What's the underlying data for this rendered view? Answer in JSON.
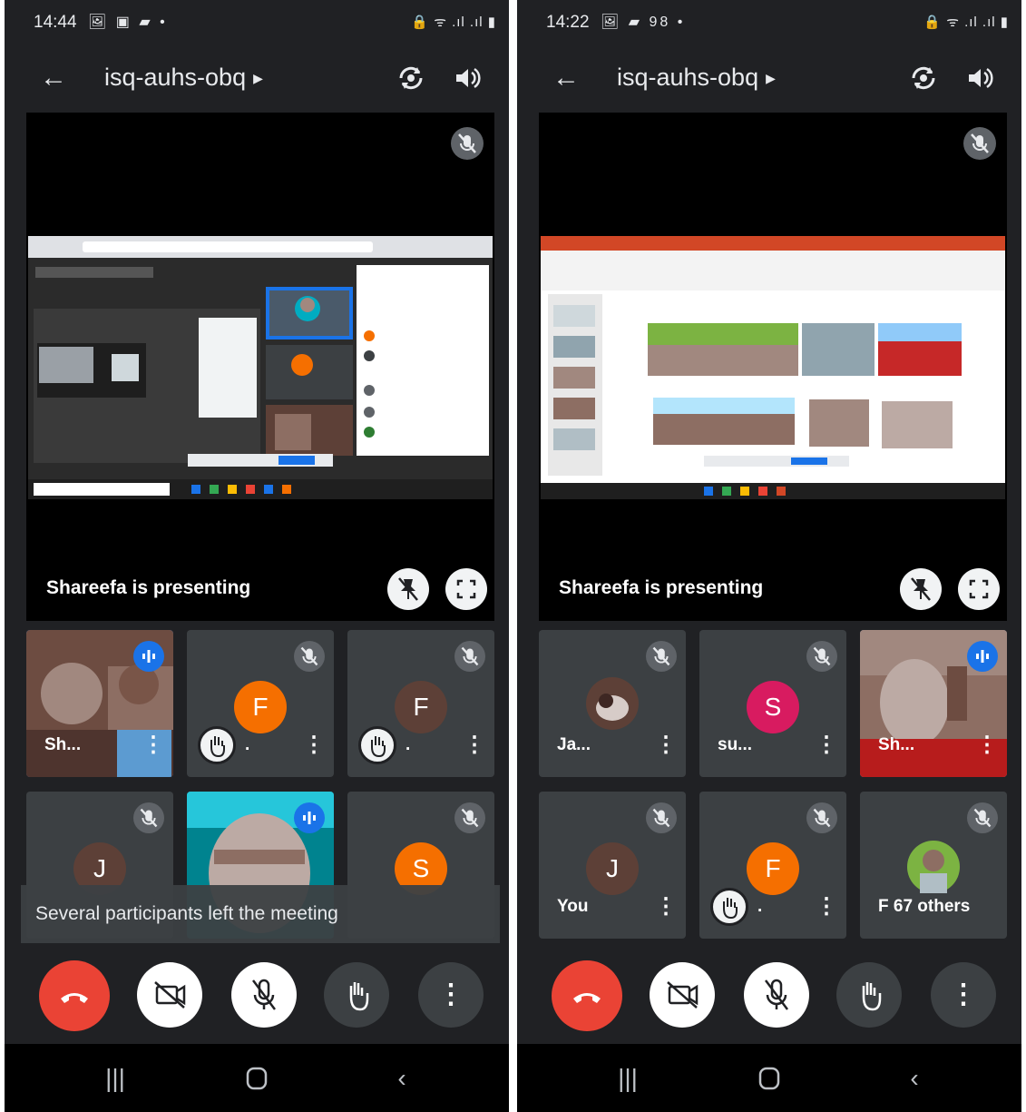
{
  "screens": [
    {
      "status": {
        "time": "14:44",
        "notif_icons": "🖼 ▣ ▰ •"
      },
      "meeting_code": "isq-auhs-obq",
      "presenter_label": "Shareefa is presenting",
      "toast": "Several participants left the meeting",
      "tiles": [
        {
          "name": "Sh...",
          "kind": "video",
          "speaking": true
        },
        {
          "name": ".",
          "kind": "avatar",
          "initial": "F",
          "avatar_color": "#f56f00",
          "hand_raised": true,
          "muted": true
        },
        {
          "name": ".",
          "kind": "avatar",
          "initial": "F",
          "avatar_color": "#5d4037",
          "hand_raised": true,
          "muted": true
        },
        {
          "name": "",
          "kind": "avatar",
          "initial": "J",
          "avatar_color": "#5d4037",
          "muted": true
        },
        {
          "name": "",
          "kind": "video",
          "speaking": true
        },
        {
          "name": "",
          "kind": "avatar",
          "initial": "S",
          "avatar_color": "#f56f00",
          "muted": true
        }
      ]
    },
    {
      "status": {
        "time": "14:22",
        "notif_icons": "🖼 ▰ 98 •"
      },
      "meeting_code": "isq-auhs-obq",
      "presenter_label": "Shareefa is presenting",
      "tiles": [
        {
          "name": "Ja...",
          "kind": "photo",
          "muted": true
        },
        {
          "name": "su...",
          "kind": "avatar",
          "initial": "S",
          "avatar_color": "#d81b60",
          "muted": true
        },
        {
          "name": "Sh...",
          "kind": "video",
          "speaking": true
        },
        {
          "name": "You",
          "kind": "avatar",
          "initial": "J",
          "avatar_color": "#5d4037",
          "muted": true
        },
        {
          "name": ".",
          "kind": "avatar",
          "initial": "F",
          "avatar_color": "#f56f00",
          "hand_raised": true,
          "muted": true
        },
        {
          "name": "F 67 others",
          "kind": "group",
          "muted": true
        }
      ]
    }
  ],
  "colors": {
    "end_call": "#ea4335",
    "speaking": "#1a73e8",
    "background": "#202124",
    "tile": "#3c4043"
  },
  "icons": {
    "back": "arrow-left-icon",
    "switch_camera": "camera-switch-icon",
    "speaker": "speaker-icon",
    "mic_off": "mic-off-icon",
    "pin": "pin-icon",
    "fullscreen": "fullscreen-icon",
    "end_call": "phone-hangup-icon",
    "camera_off": "camera-off-icon",
    "hand": "raise-hand-icon",
    "more": "more-vert-icon"
  }
}
